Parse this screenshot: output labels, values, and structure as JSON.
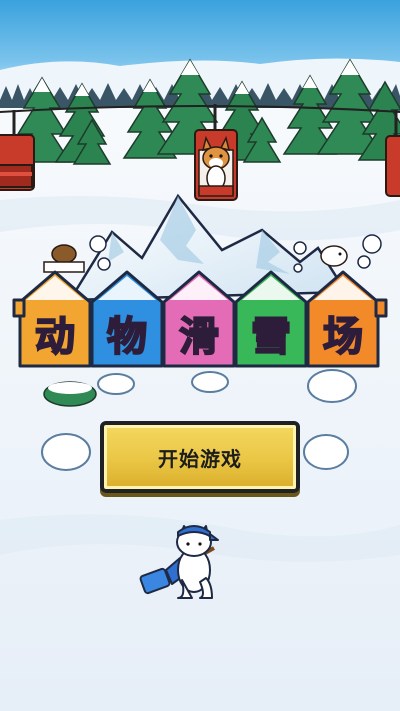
{
  "game": {
    "title_chars": [
      "动",
      "物",
      "滑",
      "雪",
      "场"
    ],
    "start_button_label": "开始游戏"
  },
  "colors": {
    "sky_top": "#4aa8e0",
    "sky_bottom": "#bfe4f6",
    "house_orange": "#f2a530",
    "house_blue": "#2f8fe0",
    "house_pink": "#e46cb6",
    "house_green": "#38b858",
    "house_orange2": "#f38a2a",
    "button_yellow": "#eac644"
  }
}
